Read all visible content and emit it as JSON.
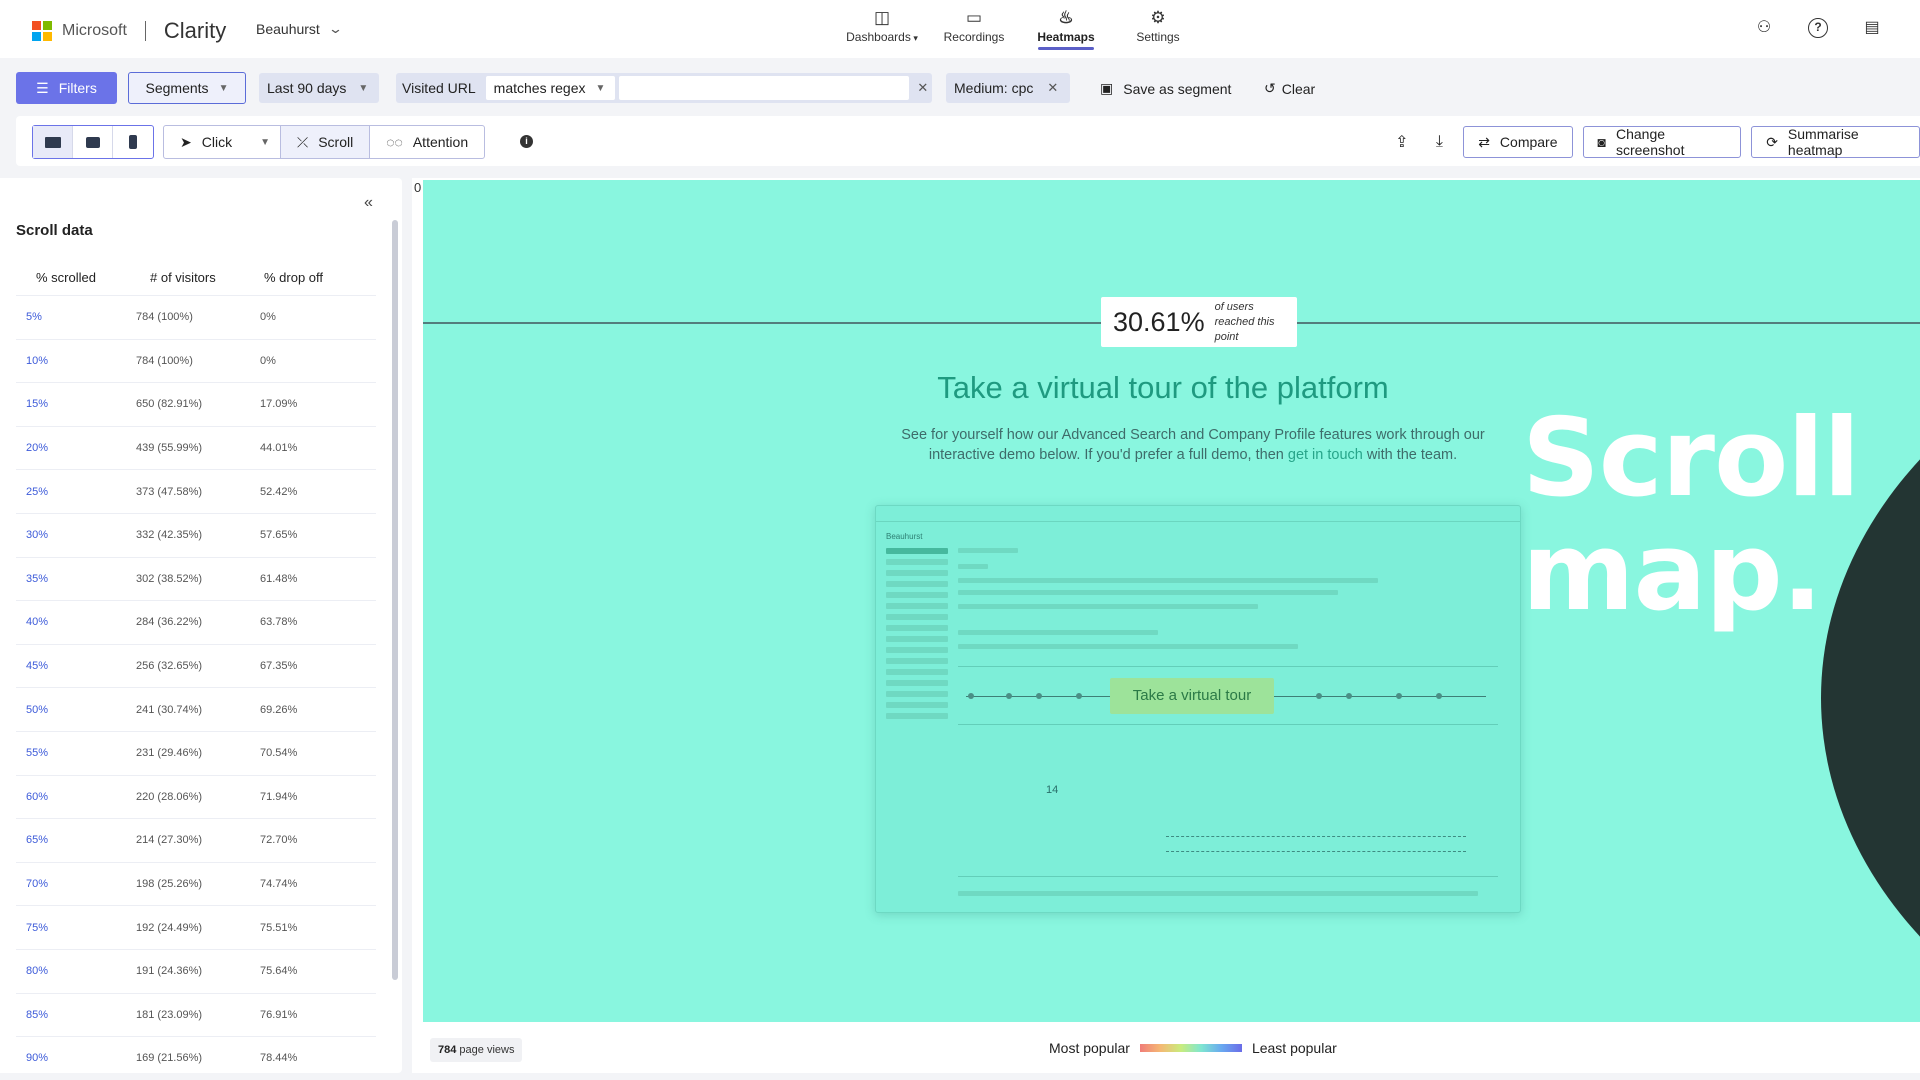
{
  "header": {
    "brand_ms": "Microsoft",
    "brand_app": "Clarity",
    "project": "Beauhurst",
    "nav": [
      {
        "label": "Dashboards",
        "icon": "dashboard-icon"
      },
      {
        "label": "Recordings",
        "icon": "video-icon"
      },
      {
        "label": "Heatmaps",
        "icon": "flame-icon",
        "active": true
      },
      {
        "label": "Settings",
        "icon": "gear-icon"
      }
    ]
  },
  "filters": {
    "filters_label": "Filters",
    "segments_label": "Segments",
    "date_range": "Last 90 days",
    "url_field": "Visited URL",
    "url_condition": "matches regex",
    "url_value": "",
    "medium": "Medium: cpc",
    "save_segment": "Save as segment",
    "clear": "Clear"
  },
  "toolbar": {
    "modes": {
      "click": "Click",
      "scroll": "Scroll",
      "attention": "Attention"
    },
    "compare": "Compare",
    "change_screenshot": "Change screenshot",
    "summarise": "Summarise heatmap"
  },
  "panel": {
    "title": "Scroll data",
    "headers": {
      "scrolled": "% scrolled",
      "visitors": "# of visitors",
      "dropoff": "% drop off"
    },
    "rows": [
      {
        "scrolled": "5%",
        "visitors": "784 (100%)",
        "dropoff": "0%"
      },
      {
        "scrolled": "10%",
        "visitors": "784 (100%)",
        "dropoff": "0%"
      },
      {
        "scrolled": "15%",
        "visitors": "650 (82.91%)",
        "dropoff": "17.09%"
      },
      {
        "scrolled": "20%",
        "visitors": "439 (55.99%)",
        "dropoff": "44.01%"
      },
      {
        "scrolled": "25%",
        "visitors": "373 (47.58%)",
        "dropoff": "52.42%"
      },
      {
        "scrolled": "30%",
        "visitors": "332 (42.35%)",
        "dropoff": "57.65%"
      },
      {
        "scrolled": "35%",
        "visitors": "302 (38.52%)",
        "dropoff": "61.48%"
      },
      {
        "scrolled": "40%",
        "visitors": "284 (36.22%)",
        "dropoff": "63.78%"
      },
      {
        "scrolled": "45%",
        "visitors": "256 (32.65%)",
        "dropoff": "67.35%"
      },
      {
        "scrolled": "50%",
        "visitors": "241 (30.74%)",
        "dropoff": "69.26%"
      },
      {
        "scrolled": "55%",
        "visitors": "231 (29.46%)",
        "dropoff": "70.54%"
      },
      {
        "scrolled": "60%",
        "visitors": "220 (28.06%)",
        "dropoff": "71.94%"
      },
      {
        "scrolled": "65%",
        "visitors": "214 (27.30%)",
        "dropoff": "72.70%"
      },
      {
        "scrolled": "70%",
        "visitors": "198 (25.26%)",
        "dropoff": "74.74%"
      },
      {
        "scrolled": "75%",
        "visitors": "192 (24.49%)",
        "dropoff": "75.51%"
      },
      {
        "scrolled": "80%",
        "visitors": "191 (24.36%)",
        "dropoff": "75.64%"
      },
      {
        "scrolled": "85%",
        "visitors": "181 (23.09%)",
        "dropoff": "76.91%"
      },
      {
        "scrolled": "90%",
        "visitors": "169 (21.56%)",
        "dropoff": "78.44%"
      }
    ]
  },
  "heatmap": {
    "zero_label": "0",
    "reach_percent": "30.61%",
    "reach_note": "of users reached this point",
    "page_title": "Take a virtual tour of the platform",
    "page_sub_1": "See for yourself how our Advanced Search and Company Profile features work through our interactive demo below. If you'd prefer a full demo, then",
    "page_sub_link": "get in touch",
    "page_sub_2": "with the team.",
    "mock_brand": "Beauhurst",
    "tour_button": "Take a virtual tour",
    "mock_number": "14",
    "colors": {
      "heat": "#89f6df",
      "overlay": "#233533"
    }
  },
  "overlay": {
    "line1": "Scroll",
    "line2": "map."
  },
  "footer": {
    "page_views_count": "784",
    "page_views_label": "page views",
    "legend_most": "Most popular",
    "legend_least": "Least popular"
  }
}
